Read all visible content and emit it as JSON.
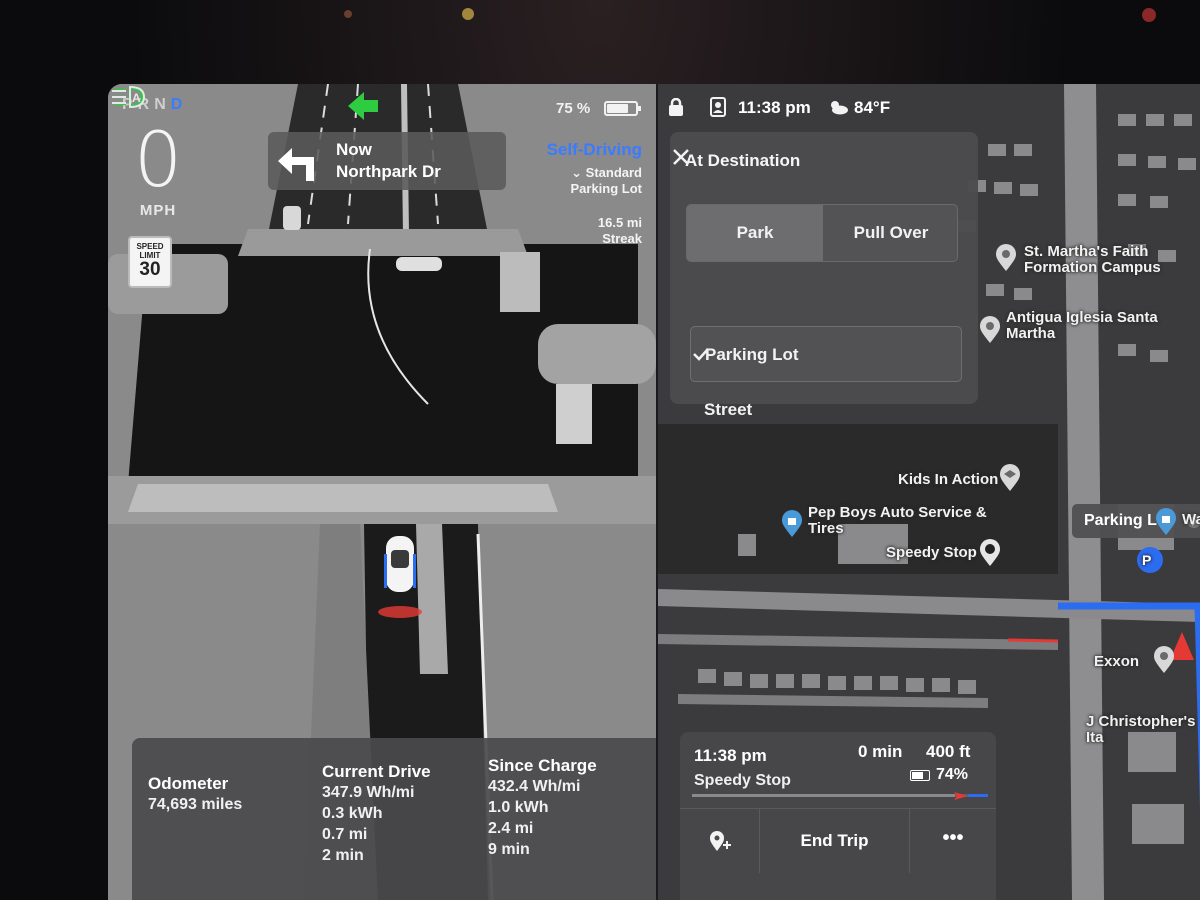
{
  "drive": {
    "gears": [
      "P",
      "R",
      "N",
      "D"
    ],
    "active_gear": "D",
    "speed": "0",
    "speed_unit": "MPH",
    "speed_limit_label": "SPEED LIMIT",
    "speed_limit": "30",
    "battery_pct": "75 %",
    "battery_level": 75,
    "turn": {
      "line1": "Now",
      "line2": "Northpark Dr"
    },
    "self_driving": {
      "title": "Self-Driving",
      "mode_line1": "Standard",
      "mode_line2": "Parking Lot",
      "streak_value": "16.5 mi",
      "streak_label": "Streak"
    }
  },
  "stats": {
    "odometer": {
      "label": "Odometer",
      "value": "74,693 miles"
    },
    "current_drive": {
      "label": "Current Drive",
      "values": [
        "347.9 Wh/mi",
        "0.3 kWh",
        "0.7 mi",
        "2 min"
      ]
    },
    "since_charge": {
      "label": "Since Charge",
      "values": [
        "432.4 Wh/mi",
        "1.0 kWh",
        "2.4 mi",
        "9 min"
      ]
    }
  },
  "status_bar": {
    "time": "11:38 pm",
    "temperature": "84°F"
  },
  "destination_panel": {
    "title": "At Destination",
    "segment": [
      "Park",
      "Pull Over"
    ],
    "active_segment": "Park",
    "options": [
      "Parking Lot",
      "Street"
    ],
    "selected_option": "Parking Lot"
  },
  "map": {
    "pois": {
      "st_martha_1": "St. Martha's Faith",
      "st_martha_2": "Formation Campus",
      "antigua_1": "Antigua Iglesia Santa",
      "antigua_2": "Martha",
      "kids": "Kids In Action",
      "pep_1": "Pep Boys Auto Service &",
      "pep_2": "Tires",
      "speedy": "Speedy Stop",
      "exxon": "Exxon",
      "jchris": "J Christopher's Ita",
      "wa": "Wa"
    },
    "parking_chip": "Parking Lot",
    "parking_symbol": "P"
  },
  "trip": {
    "arrival_time": "11:38 pm",
    "destination": "Speedy Stop",
    "duration": "0 min",
    "distance": "400 ft",
    "battery_at_arrival": "74%",
    "progress": 0.9,
    "end_label": "End Trip",
    "more": "•••"
  },
  "colors": {
    "accent_blue": "#3b7bff",
    "route_blue": "#2b6cf0",
    "nav_green": "#2ecc40",
    "position_red": "#e53935"
  }
}
